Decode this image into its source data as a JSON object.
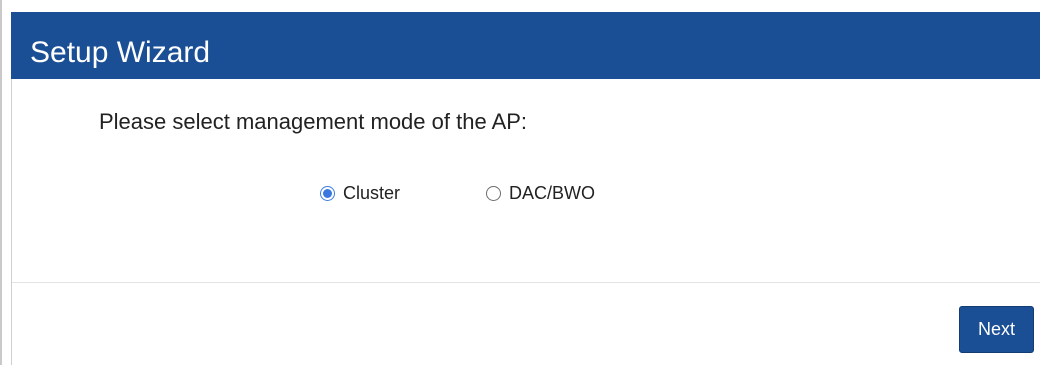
{
  "wizard": {
    "title": "Setup Wizard",
    "prompt": "Please select management mode of the AP:",
    "options": [
      {
        "label": "Cluster",
        "selected": true
      },
      {
        "label": "DAC/BWO",
        "selected": false
      }
    ],
    "next_label": "Next"
  },
  "colors": {
    "header_bg": "#1a4f95",
    "button_bg": "#1a4f95",
    "radio_accent": "#3a78e0"
  }
}
